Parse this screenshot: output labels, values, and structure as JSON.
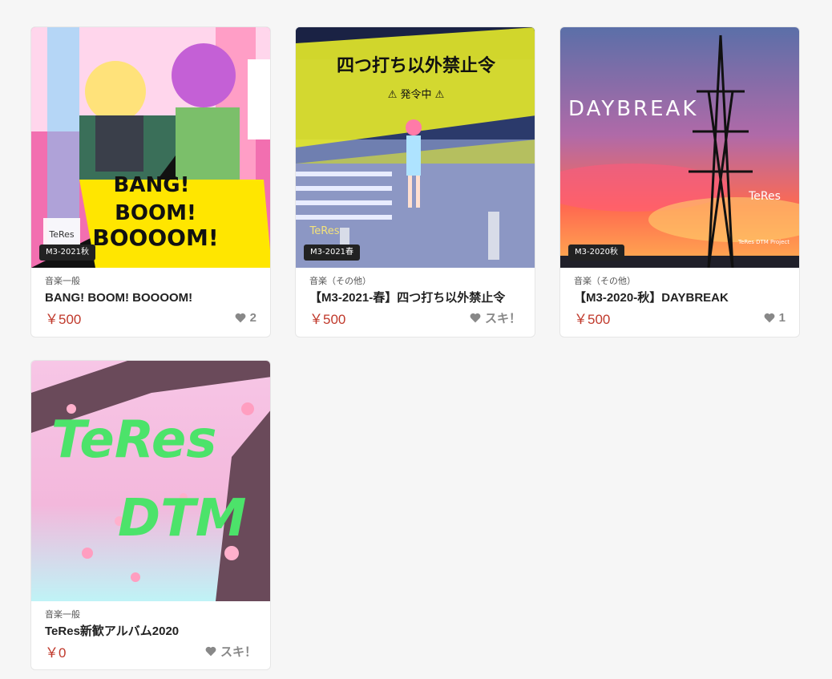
{
  "items": [
    {
      "badge": "M3-2021秋",
      "category": "音楽一般",
      "title": "BANG! BOOM! BOOOOM!",
      "price": "￥500",
      "likes": "2",
      "art_text": [
        "BANG!",
        "BOOM!",
        "BOOOOM!"
      ],
      "logo": "TeRes"
    },
    {
      "badge": "M3-2021春",
      "category": "音楽（その他）",
      "title": "【M3-2021-春】四つ打ち以外禁止令",
      "price": "￥500",
      "likes": "スキ！",
      "art_text": [
        "四つ打ち以外禁止令",
        "⚠ 発令中 ⚠"
      ],
      "logo": "TeRes"
    },
    {
      "badge": "M3-2020秋",
      "category": "音楽（その他）",
      "title": "【M3-2020-秋】DAYBREAK",
      "price": "￥500",
      "likes": "1",
      "art_text": [
        "DAYBREAK",
        "TeRes DTM Project"
      ],
      "logo": "TeRes"
    },
    {
      "category": "音楽一般",
      "title": "TeRes新歓アルバム2020",
      "price": "￥0",
      "likes": "スキ！",
      "art_text": [
        "TeRes",
        "DTM"
      ]
    }
  ]
}
